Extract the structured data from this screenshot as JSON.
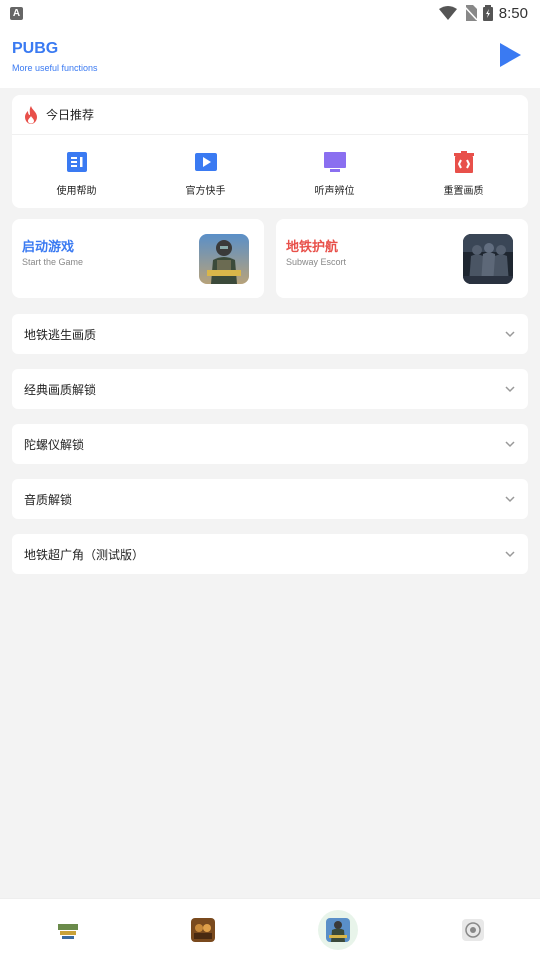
{
  "status_bar": {
    "time": "8:50",
    "notif_letter": "A"
  },
  "header": {
    "title": "PUBG",
    "subtitle": "More useful functions"
  },
  "recommend": {
    "title": "今日推荐",
    "items": [
      {
        "label": "使用帮助",
        "icon": "document-list-icon",
        "color": "#3a7af2"
      },
      {
        "label": "官方快手",
        "icon": "video-play-icon",
        "color": "#3a7af2"
      },
      {
        "label": "听声辨位",
        "icon": "monitor-icon",
        "color": "#8a6ff0"
      },
      {
        "label": "重置画质",
        "icon": "trash-icon",
        "color": "#e8504a"
      }
    ]
  },
  "games": [
    {
      "title": "启动游戏",
      "subtitle": "Start the Game",
      "color": "#3a7af2"
    },
    {
      "title": "地铁护航",
      "subtitle": "Subway Escort",
      "color": "#e8504a"
    }
  ],
  "sections": [
    {
      "label": "地铁逃生画质"
    },
    {
      "label": "经典画质解锁"
    },
    {
      "label": "陀螺仪解锁"
    },
    {
      "label": "音质解锁"
    },
    {
      "label": "地铁超广角（测试版）"
    }
  ],
  "colors": {
    "accent": "#3a7af2",
    "red": "#e8504a",
    "purple": "#8a6ff0",
    "background": "#f3f3f3"
  }
}
